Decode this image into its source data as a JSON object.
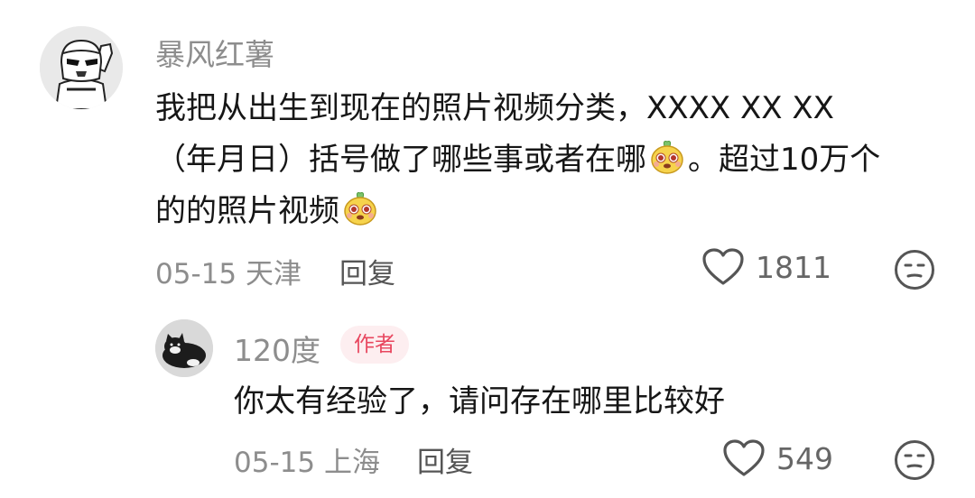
{
  "main_comment": {
    "username": "暴风红薯",
    "lines": [
      {
        "text": "我把从出生到现在的照片视频分类，XXXX XX XX"
      },
      {
        "before": "（年月日）括号做了哪些事或者在哪",
        "after": "。超过10万个"
      },
      {
        "before": "的的照片视频",
        "after": ""
      }
    ],
    "emoji_icon": "pineapple-face-emoji",
    "date": "05-15",
    "location": "天津",
    "reply_label": "回复",
    "like_count": "1811"
  },
  "reply": {
    "username": "120度",
    "badge": "作者",
    "text": "你太有经验了，请问存在哪里比较好",
    "date": "05-15",
    "location": "上海",
    "reply_label": "回复",
    "like_count": "549"
  },
  "icons": {
    "like": "heart-outline-icon",
    "dislike": "meh-face-icon"
  },
  "colors": {
    "username": "#8d8d8d",
    "badge_text": "#e8475f",
    "badge_bg": "#fdeef0",
    "text": "#161616"
  }
}
